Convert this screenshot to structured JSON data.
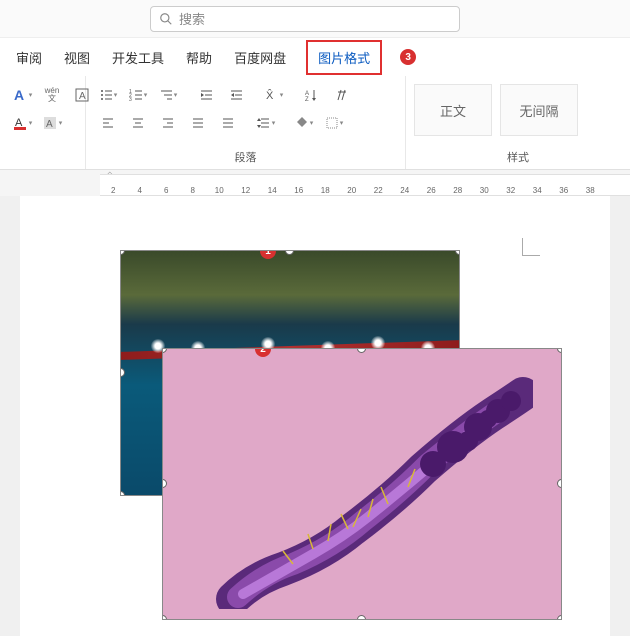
{
  "search": {
    "placeholder": "搜索"
  },
  "tabs": {
    "items": [
      "审阅",
      "视图",
      "开发工具",
      "帮助",
      "百度网盘",
      "图片格式"
    ],
    "active_index": 5,
    "callout_label": "3"
  },
  "ribbon": {
    "font": {
      "wen": "wén",
      "wenzi": "文"
    },
    "paragraph": {
      "label": "段落"
    },
    "styles": {
      "label": "样式",
      "tiles": [
        "正文",
        "无间隔"
      ]
    }
  },
  "ruler": {
    "ticks": [
      "2",
      "4",
      "6",
      "8",
      "10",
      "12",
      "14",
      "16",
      "18",
      "20",
      "22",
      "24",
      "26",
      "28",
      "30",
      "32",
      "34",
      "36",
      "38"
    ]
  },
  "callouts": {
    "img1": "1",
    "img2": "2"
  }
}
